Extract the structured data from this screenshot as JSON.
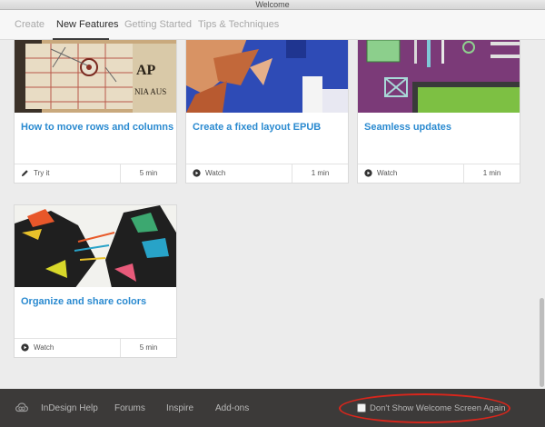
{
  "window": {
    "title": "Welcome"
  },
  "tabs": [
    {
      "label": "Create"
    },
    {
      "label": "New Features"
    },
    {
      "label": "Getting Started"
    },
    {
      "label": "Tips & Techniques"
    }
  ],
  "active_tab": "New Features",
  "cards": [
    {
      "title": "How to move rows and columns",
      "action_label": "Try it",
      "action_icon": "pencil-icon",
      "duration": "5 min"
    },
    {
      "title": "Create a fixed layout EPUB",
      "action_label": "Watch",
      "action_icon": "play-icon",
      "duration": "1 min"
    },
    {
      "title": "Seamless updates",
      "action_label": "Watch",
      "action_icon": "play-icon",
      "duration": "1 min"
    },
    {
      "title": "Organize and share colors",
      "action_label": "Watch",
      "action_icon": "play-icon",
      "duration": "5 min"
    }
  ],
  "footer": {
    "logo_icon": "creative-cloud-icon",
    "links": [
      {
        "label": "InDesign Help"
      },
      {
        "label": "Forums"
      },
      {
        "label": "Inspire"
      },
      {
        "label": "Add-ons"
      }
    ],
    "dont_show_label": "Don't Show Welcome Screen Again",
    "dont_show_checked": false
  },
  "colors": {
    "accent": "#2a8ad0",
    "footer_bg": "#3c3a39",
    "highlight_ring": "#d9261c"
  }
}
